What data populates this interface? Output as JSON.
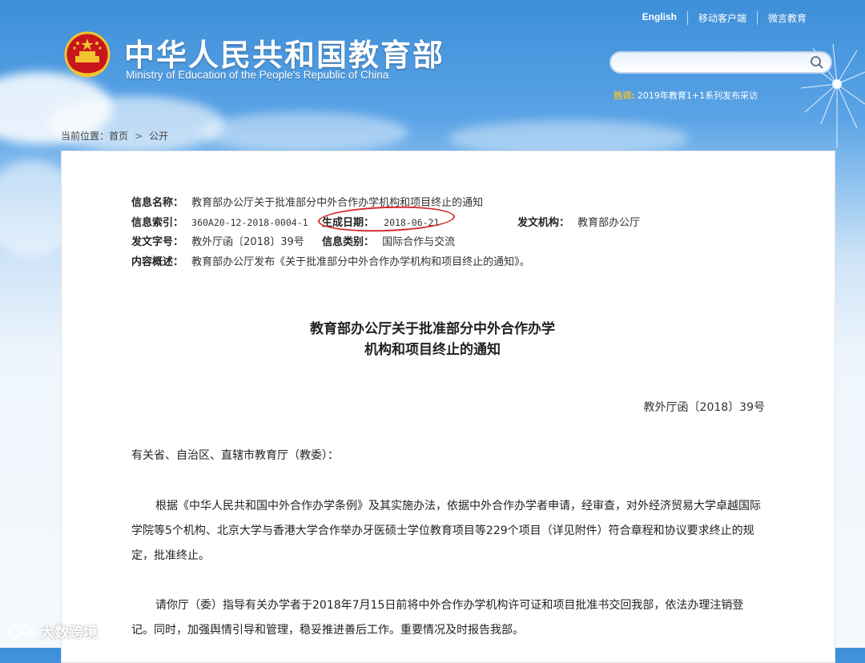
{
  "header": {
    "brand_cn": "中华人民共和国教育部",
    "brand_en": "Ministry of Education of the People's Republic of China",
    "top_links": [
      "English",
      "移动客户端",
      "微言教育"
    ],
    "search_placeholder": "",
    "hot_label": "热词:",
    "hot_text": "2019年教育1+1系列发布采访"
  },
  "breadcrumb": {
    "prefix": "当前位置：",
    "home": "首页",
    "separator": ">",
    "current": "公开"
  },
  "meta": {
    "name_label": "信息名称：",
    "name_value": "教育部办公厅关于批准部分中外合作办学机构和项目终止的通知",
    "index_label": "信息索引：",
    "index_value": "360A20-12-2018-0004-1",
    "date_label": "生成日期：",
    "date_value": "2018-06-21",
    "issuer_label": "发文机构：",
    "issuer_value": "教育部办公厅",
    "docno_label": "发文字号：",
    "docno_value": "教外厅函〔2018〕39号",
    "category_label": "信息类别：",
    "category_value": "国际合作与交流",
    "summary_label": "内容概述：",
    "summary_value": "教育部办公厅发布《关于批准部分中外合作办学机构和项目终止的通知》。"
  },
  "document": {
    "title_line1": "教育部办公厅关于批准部分中外合作办学",
    "title_line2": "机构和项目终止的通知",
    "doc_number": "教外厅函〔2018〕39号",
    "salutation": "有关省、自治区、直辖市教育厅（教委）：",
    "paragraph1": "根据《中华人民共和国中外合作办学条例》及其实施办法，依据中外合作办学者申请，经审查，对外经济贸易大学卓越国际学院等5个机构、北京大学与香港大学合作举办牙医硕士学位教育项目等229个项目（详见附件）符合章程和协议要求终止的规定，批准终止。",
    "paragraph2": "请你厅（委）指导有关办学者于2018年7月15日前将中外合作办学机构许可证和项目批准书交回我部，依法办理注销登记。同时，加强舆情引导和管理，稳妥推进善后工作。重要情况及时报告我部。"
  },
  "watermark": {
    "text": "大数跨境"
  },
  "colors": {
    "highlight_ellipse": "#d62b2b",
    "hot_label": "#f5c12e"
  }
}
